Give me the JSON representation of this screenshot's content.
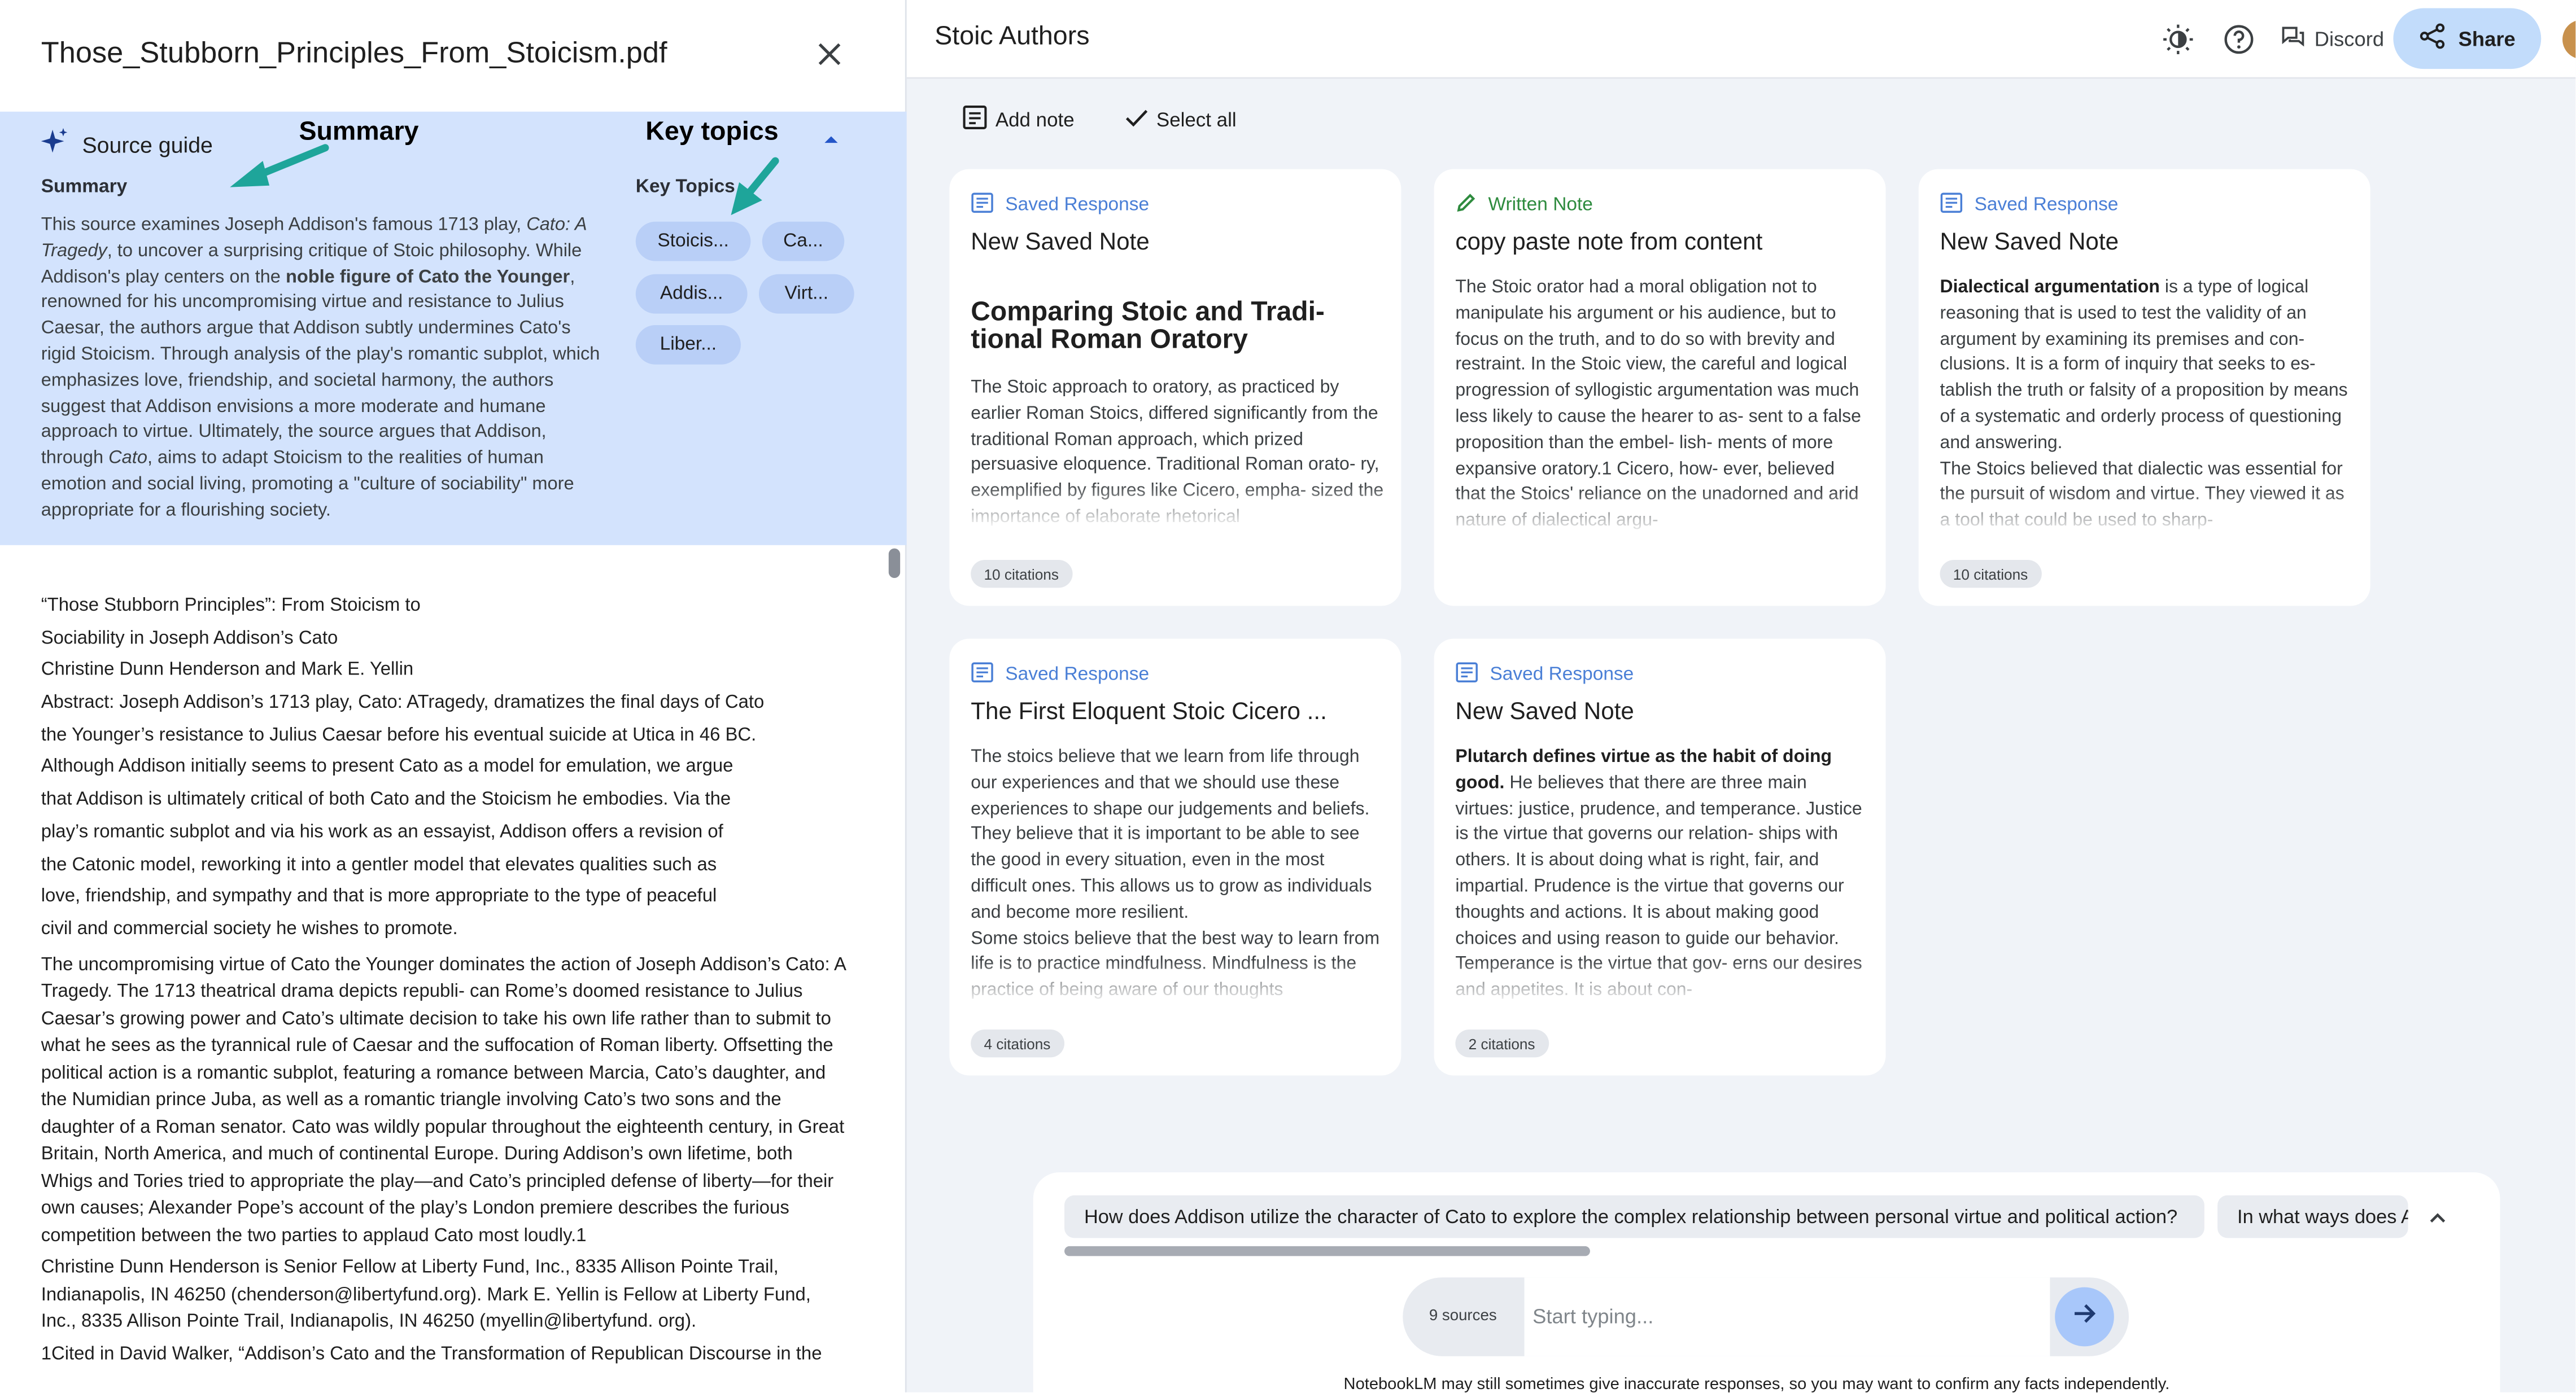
{
  "source_panel": {
    "title": "Those_Stubborn_Principles_From_Stoicism.pdf",
    "guide_label": "Source guide",
    "annotations": {
      "summary": "Summary",
      "key_topics": "Key topics"
    },
    "summary_label": "Summary",
    "summary_parts": {
      "p1": "This source examines Joseph Addison's famous 1713 play, ",
      "p1_italic": "Cato: A Tragedy",
      "p2": ", to uncover a surprising critique of Stoic philosophy. While Addison's play centers on the ",
      "p2_bold": "noble figure of Cato the Younger",
      "p3": ", renowned for his uncompromising virtue and resistance to Julius Caesar, the authors argue that Addison subtly undermines Cato's rigid Stoicism. Through analysis of the play's romantic subplot, which emphasizes love, friendship, and societal harmony, the authors suggest that Addison envisions a more moderate and humane approach to virtue. Ultimately, the source argues that Addison, through ",
      "p3_italic": "Cato",
      "p4": ", aims to adapt Stoicism to the realities of human emotion and social living, promoting a \"culture of sociability\" more appropriate for a flourishing society."
    },
    "key_topics_label": "Key Topics",
    "topics": [
      "Stoicis...",
      "Ca...",
      "Addis...",
      "Virt...",
      "Liber..."
    ],
    "doc_lines": [
      "“Those Stubborn Principles”: From Stoicism to",
      "Sociability in Joseph Addison’s Cato",
      "Christine Dunn Henderson and Mark E. Yellin",
      "Abstract: Joseph Addison’s 1713 play, Cato: ATragedy, dramatizes the final days of Cato",
      "the Younger’s resistance to Julius Caesar before his eventual suicide at Utica in 46 BC.",
      "Although Addison initially seems to present Cato as a model for emulation, we argue",
      "that Addison is ultimately critical of both Cato and the Stoicism he embodies. Via the",
      "play’s romantic subplot and via his work as an essayist, Addison offers a revision of",
      "the Catonic model, reworking it into a gentler model that elevates qualities such as",
      "love, friendship, and sympathy and that is more appropriate to the type of peaceful",
      "civil and commercial society he wishes to promote."
    ],
    "doc_para_1": "The uncompromising virtue of Cato the Younger dominates the action of Joseph Addison’s Cato: A Tragedy. The 1713 theatrical drama depicts republi- can Rome’s doomed resistance to Julius Caesar’s growing power and Cato’s ultimate decision to take his own life rather than to submit to what he sees as the tyrannical rule of Caesar and the suffocation of Roman liberty. Offsetting the political action is a romantic subplot, featuring a romance between Marcia, Cato’s daughter, and the Numidian prince Juba, as well as a romantic triangle involving Cato’s two sons and the daughter of a Roman senator. Cato was wildly popular throughout the eighteenth century, in Great Britain, North America, and much of continental Europe. During Addison’s own lifetime, both Whigs and Tories tried to appropriate the play—and Cato’s principled defense of liberty—for their own causes; Alexander Pope’s account of the play’s London premiere describes the furious competition between the two parties to applaud Cato most loudly.1",
    "doc_para_2": "Christine Dunn Henderson is Senior Fellow at Liberty Fund, Inc., 8335 Allison Pointe Trail, Indianapolis, IN 46250 (chenderson@libertyfund.org). Mark E. Yellin is Fellow at Liberty Fund, Inc., 8335 Allison Pointe Trail, Indianapolis, IN 46250 (myellin@libertyfund. org).",
    "doc_para_3": "1Cited in David Walker, “Addison’s Cato and the Transformation of Republican Discourse in the"
  },
  "notebook": {
    "title": "Stoic Authors",
    "discord_label": "Discord",
    "share_label": "Share",
    "add_note_label": "Add note",
    "select_all_label": "Select all",
    "colors": {
      "saved": "#4a7fd6",
      "written": "#2e8b3e",
      "share_bg": "#c2dcfb",
      "guide_bg": "#d3e3fd"
    },
    "cards": [
      {
        "type": "Saved Response",
        "title": "New Saved Note",
        "heading": "Comparing Stoic and Tradi- tional Roman Oratory",
        "body": "The Stoic approach to oratory, as practiced by earlier Roman Stoics, differed significantly from the traditional Roman approach, which prized persuasive eloquence. Traditional Roman orato- ry, exemplified by figures like Cicero, empha- sized the importance of elaborate rhetorical",
        "citations": "10 citations"
      },
      {
        "type": "Written Note",
        "title": "copy paste note from content",
        "body": "The Stoic orator had a moral obligation not to manipulate his argument or his audience, but to focus on the truth, and to do so with brevity and restraint. In the Stoic view, the careful and logical progression of syllogistic argumentation was much less likely to cause the hearer to as- sent to a false proposition than the embel- lish- ments of more expansive oratory.1 Cicero, how- ever, believed that the Stoics' reliance on the unadorned and arid nature of dialectical argu-"
      },
      {
        "type": "Saved Response",
        "title": "New Saved Note",
        "bold_lead": "Dialectical argumentation",
        "body": " is a type of logical reasoning that is used to test the validity of an argument by examining its premises and con- clusions. It is a form of inquiry that seeks to es- tablish the truth or falsity of a proposition by means of a systematic and orderly process of questioning and answering.",
        "body_2": "The Stoics believed that dialectic was essential for the pursuit of wisdom and virtue. They viewed it as a tool that could be used to sharp-",
        "citations": "10 citations"
      },
      {
        "type": "Saved Response",
        "title": "The First Eloquent Stoic Cicero ...",
        "body": "The stoics believe that we learn from life through our experiences and that we should use these experiences to shape our judgements and beliefs. They believe that it is important to be able to see the good in every situation, even in the most difficult ones. This allows us to grow as individuals and become more resilient.",
        "body_2": "Some stoics believe that the best way to learn from life is to practice mindfulness. Mindfulness is the practice of being aware of our thoughts",
        "citations": "4 citations"
      },
      {
        "type": "Saved Response",
        "title": "New Saved Note",
        "bold_lead": "Plutarch defines virtue as the habit of doing good.",
        "body": " He believes that there are three main virtues: justice, prudence, and temperance. Justice is the virtue that governs our relation- ships with others. It is about doing what is right, fair, and impartial. Prudence is the virtue that governs our thoughts and actions. It is about making good choices and using reason to guide our behavior. Temperance is the virtue that gov- erns our desires and appetites. It is about con-",
        "citations": "2 citations"
      }
    ],
    "suggestions": [
      "How does Addison utilize the character of Cato to explore the complex relationship between personal virtue and political action?",
      "In what ways does A"
    ],
    "composer": {
      "sources": "9 sources",
      "placeholder": "Start typing..."
    },
    "disclaimer": "NotebookLM may still sometimes give inaccurate responses, so you may want to confirm any facts independently."
  }
}
